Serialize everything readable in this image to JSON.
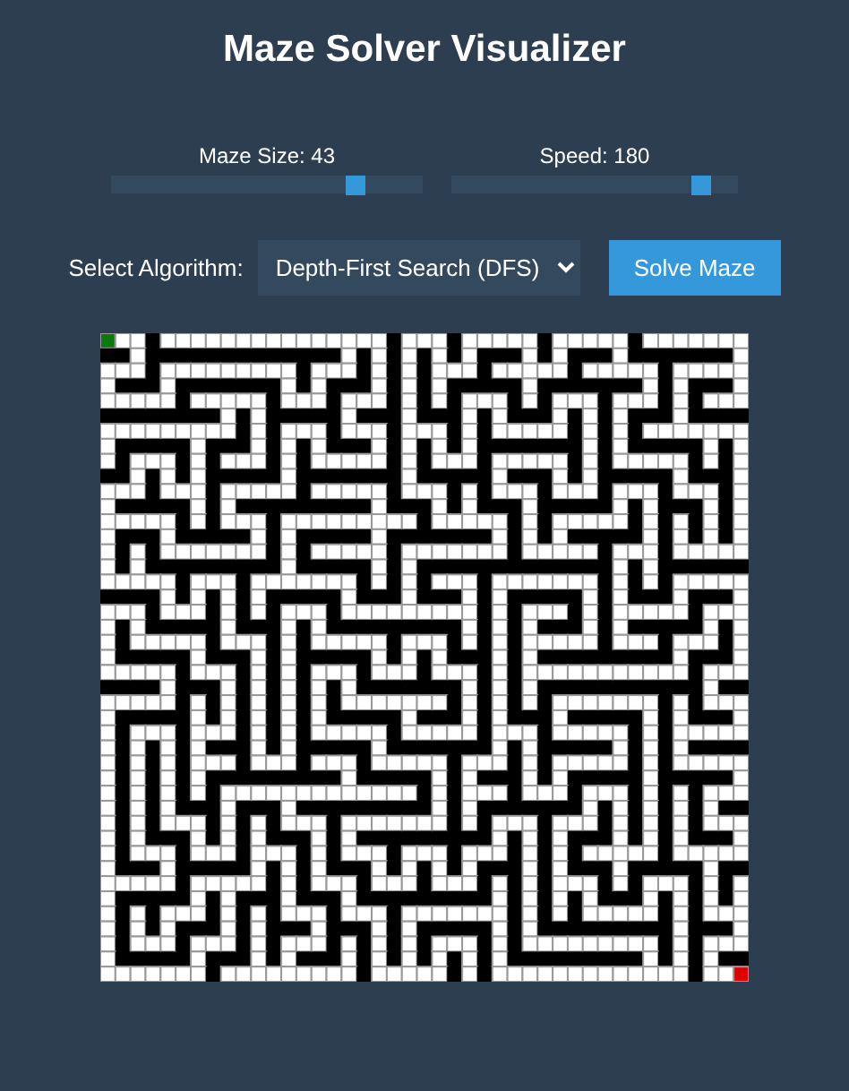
{
  "title": "Maze Solver Visualizer",
  "sliders": [
    {
      "label": "Maze Size: 43",
      "level": 0.78
    },
    {
      "label": "Speed: 180",
      "level": 0.87
    }
  ],
  "algorithm": {
    "label": "Select Algorithm:",
    "value": "Depth-First Search (DFS)"
  },
  "solve_button": "Solve Maze"
}
